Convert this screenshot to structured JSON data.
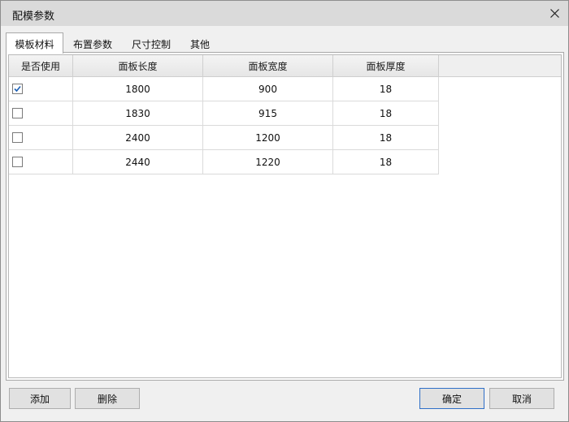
{
  "window": {
    "title": "配模参数",
    "close_icon": "close-icon"
  },
  "tabs": [
    {
      "label": "模板材料",
      "active": true
    },
    {
      "label": "布置参数",
      "active": false
    },
    {
      "label": "尺寸控制",
      "active": false
    },
    {
      "label": "其他",
      "active": false
    }
  ],
  "table": {
    "headers": [
      "是否使用",
      "面板长度",
      "面板宽度",
      "面板厚度"
    ],
    "rows": [
      {
        "checked": true,
        "length": "1800",
        "width": "900",
        "thickness": "18"
      },
      {
        "checked": false,
        "length": "1830",
        "width": "915",
        "thickness": "18"
      },
      {
        "checked": false,
        "length": "2400",
        "width": "1200",
        "thickness": "18"
      },
      {
        "checked": false,
        "length": "2440",
        "width": "1220",
        "thickness": "18"
      }
    ]
  },
  "buttons": {
    "add": "添加",
    "delete": "删除",
    "ok": "确定",
    "cancel": "取消"
  }
}
